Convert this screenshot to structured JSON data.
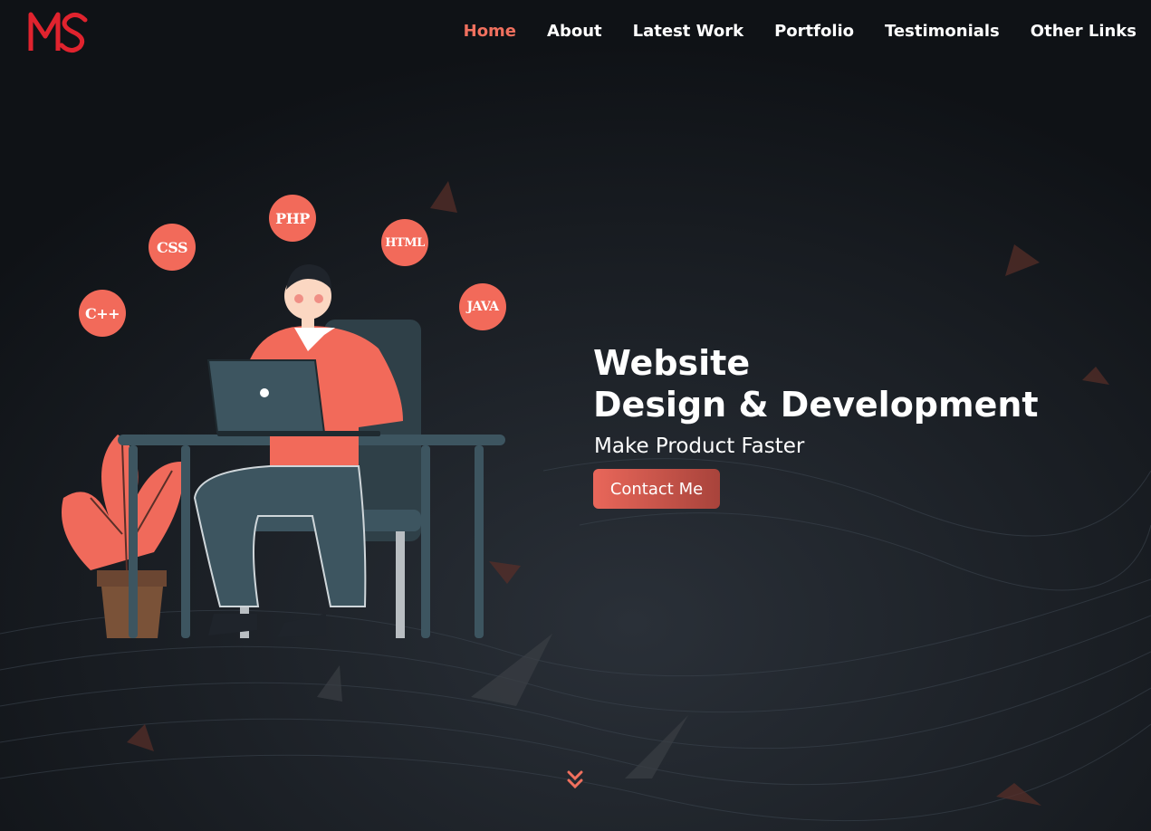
{
  "logo": {
    "text": "MS",
    "color": "#e0232e"
  },
  "nav": {
    "items": [
      {
        "label": "Home",
        "active": true
      },
      {
        "label": "About",
        "active": false
      },
      {
        "label": "Latest Work",
        "active": false
      },
      {
        "label": "Portfolio",
        "active": false
      },
      {
        "label": "Testimonials",
        "active": false
      },
      {
        "label": "Other Links",
        "active": false
      }
    ]
  },
  "skills": [
    "C++",
    "CSS",
    "PHP",
    "HTML",
    "JAVA"
  ],
  "hero": {
    "title_line1": "Website",
    "title_line2": "Design & Development",
    "tagline": "Make Product Faster",
    "cta_label": "Contact Me"
  },
  "colors": {
    "accent": "#f0705e",
    "badge": "#f26a5a",
    "background": "#13171c",
    "desk": "#3d5560"
  },
  "icons": {
    "scroll": "double-chevron-down-icon"
  }
}
